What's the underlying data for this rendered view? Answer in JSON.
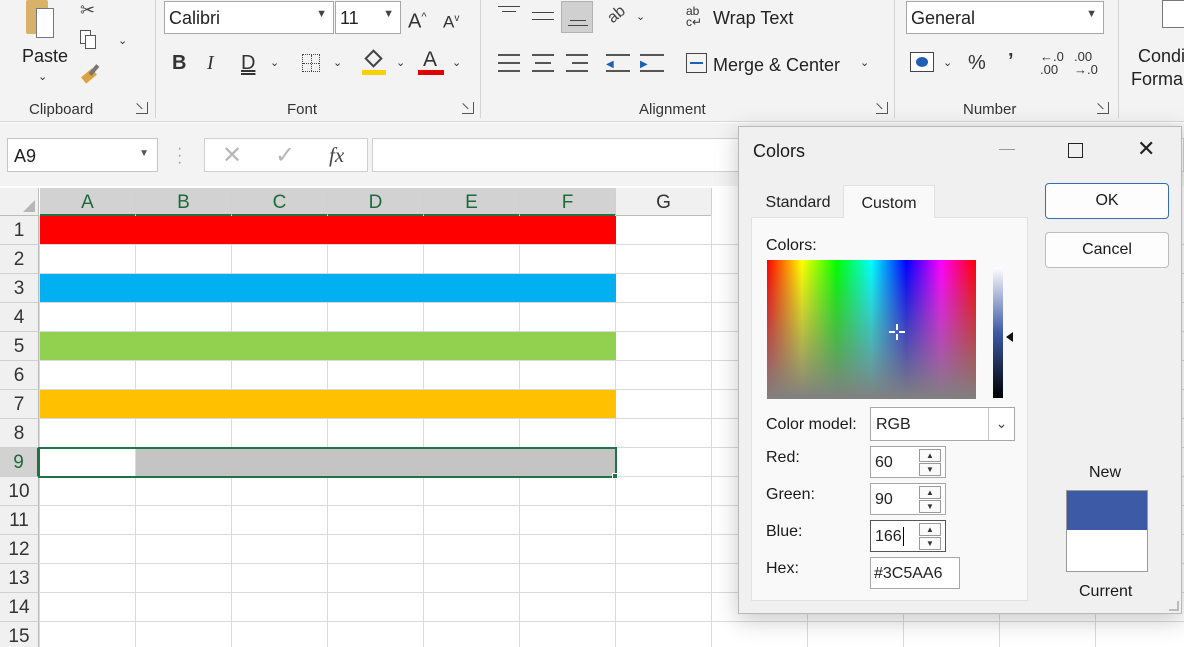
{
  "ribbon": {
    "clipboard": {
      "paste_label": "Paste",
      "group_label": "Clipboard"
    },
    "font": {
      "font_name": "Calibri",
      "font_size": "11",
      "group_label": "Font",
      "highlight_color": "#ffd000",
      "font_color": "#e00000"
    },
    "alignment": {
      "wrap_text": "Wrap Text",
      "merge_center": "Merge & Center",
      "group_label": "Alignment"
    },
    "number": {
      "format": "General",
      "percent": "%",
      "comma": "’",
      "inc_decimal_top": "←.0",
      "inc_decimal_bottom": ".00",
      "dec_decimal_top": ".00",
      "dec_decimal_bottom": "→.0",
      "group_label": "Number"
    },
    "styles": {
      "conditional_line1": "Condi",
      "conditional_line2": "Forma"
    }
  },
  "formula_bar": {
    "name_box": "A9",
    "fx": "fx",
    "value": ""
  },
  "sheet": {
    "columns": [
      "A",
      "B",
      "C",
      "D",
      "E",
      "F",
      "G"
    ],
    "rows": [
      "1",
      "2",
      "3",
      "4",
      "5",
      "6",
      "7",
      "8",
      "9",
      "10",
      "11",
      "12",
      "13",
      "14",
      "15"
    ],
    "selected_row": "9",
    "bands": [
      {
        "row": "1",
        "color": "#ff0000"
      },
      {
        "row": "3",
        "color": "#00b0f0"
      },
      {
        "row": "5",
        "color": "#92d050"
      },
      {
        "row": "7",
        "color": "#ffc000"
      }
    ],
    "selection_fill": "#c4c4c4"
  },
  "dialog": {
    "title": "Colors",
    "tabs": [
      "Standard",
      "Custom"
    ],
    "active_tab": "Custom",
    "colors_label": "Colors:",
    "color_model_label": "Color model:",
    "color_model_value": "RGB",
    "red_label": "Red:",
    "red_value": "60",
    "green_label": "Green:",
    "green_value": "90",
    "blue_label": "Blue:",
    "blue_value": "166",
    "hex_label": "Hex:",
    "hex_value": "#3C5AA6",
    "ok_label": "OK",
    "cancel_label": "Cancel",
    "new_label": "New",
    "current_label": "Current",
    "new_color": "#3c5aa6",
    "current_color": "#ffffff"
  }
}
